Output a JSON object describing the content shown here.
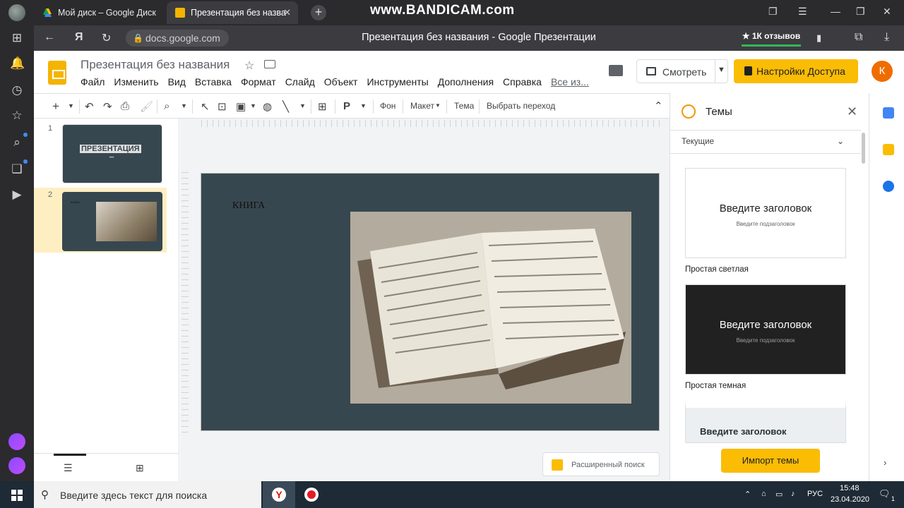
{
  "browser": {
    "tabs": [
      {
        "label": "Мой диск – Google Диск",
        "active": false
      },
      {
        "label": "Презентация без назва",
        "active": true
      }
    ],
    "watermark": "www.BANDICAM.com",
    "url": "docs.google.com",
    "page_title": "Презентация без названия - Google Презентации",
    "reviews": "★ 1К отзывов"
  },
  "doc": {
    "title": "Презентация без названия",
    "menu": [
      "Файл",
      "Изменить",
      "Вид",
      "Вставка",
      "Формат",
      "Слайд",
      "Объект",
      "Инструменты",
      "Дополнения",
      "Справка"
    ],
    "menu_more": "Все из...",
    "watch_label": "Смотреть",
    "share_label": "Настройки Доступа",
    "user_initial": "К"
  },
  "toolbar": {
    "background": "Фон",
    "layout": "Макет",
    "theme": "Тема",
    "transition": "Выбрать переход"
  },
  "slides": {
    "numbers": [
      "1",
      "2"
    ],
    "thumb1_title": "ПРЕЗЕНТАЦИЯ",
    "selected": 2
  },
  "canvas": {
    "slide_text": "КНИГА",
    "advanced_search": "Расширенный поиск"
  },
  "themes_panel": {
    "title": "Темы",
    "current_label": "Текущие",
    "cards": [
      {
        "heading": "Введите заголовок",
        "subheading": "Введите подзаголовок",
        "name": "Простая светлая"
      },
      {
        "heading": "Введите заголовок",
        "subheading": "Введите подзаголовок",
        "name": "Простая темная"
      },
      {
        "heading": "Введите заголовок"
      }
    ],
    "import_label": "Импорт темы"
  },
  "taskbar": {
    "search_placeholder": "Введите здесь текст для поиска",
    "lang": "РУС",
    "time": "15:48",
    "date": "23.04.2020",
    "notifications": "1"
  },
  "colors": {
    "accent": "#fbbc04",
    "slide_bg": "#37474f",
    "selection": "#feefc3",
    "taskbar": "#1e2a35"
  }
}
